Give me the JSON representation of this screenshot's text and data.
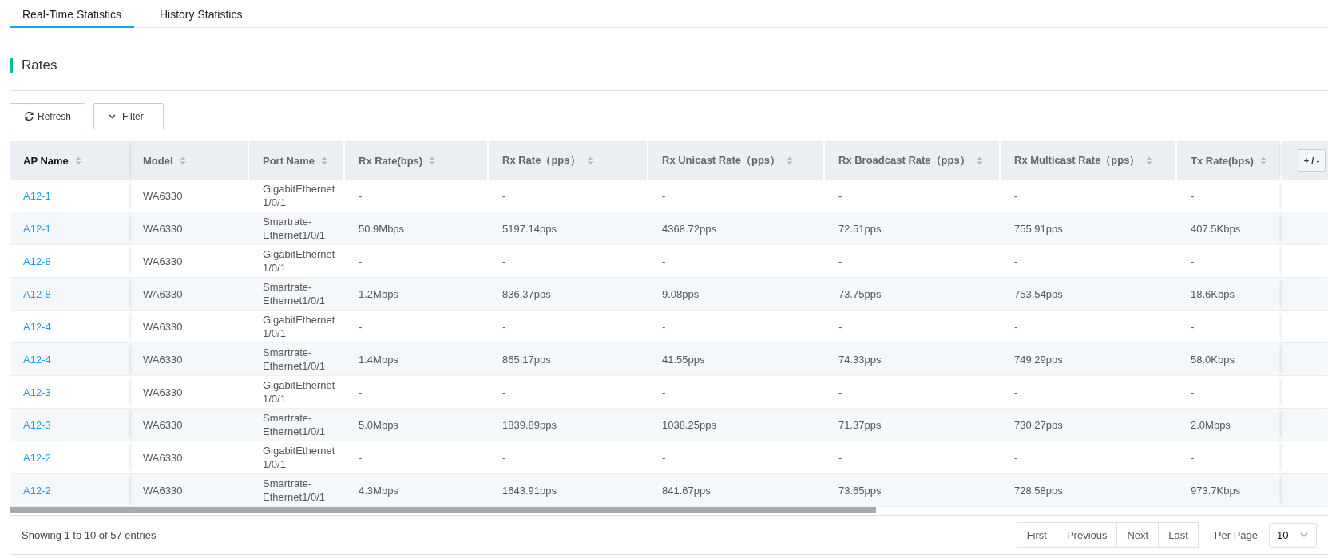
{
  "tabs": [
    {
      "label": "Real-Time Statistics",
      "selected": true
    },
    {
      "label": "History Statistics",
      "selected": false
    }
  ],
  "section": {
    "title": "Rates"
  },
  "toolbar": {
    "refresh": "Refresh",
    "filter": "Filter"
  },
  "table": {
    "columns": [
      {
        "label": "AP Name",
        "sorted": true
      },
      {
        "label": "Model",
        "sorted": false
      },
      {
        "label": "Port Name",
        "sorted": false
      },
      {
        "label": "Rx Rate(bps)",
        "sorted": false
      },
      {
        "label": "Rx Rate（pps）",
        "sorted": false
      },
      {
        "label": "Rx Unicast Rate（pps）",
        "sorted": false
      },
      {
        "label": "Rx Broadcast Rate（pps）",
        "sorted": false
      },
      {
        "label": "Rx Multicast Rate（pps）",
        "sorted": false
      },
      {
        "label": "Tx Rate(bps)",
        "sorted": false
      }
    ],
    "column_toggle": "+ / -",
    "rows": [
      [
        "A12-1",
        "WA6330",
        "GigabitEthernet 1/0/1",
        "-",
        "-",
        "-",
        "-",
        "-",
        "-"
      ],
      [
        "A12-1",
        "WA6330",
        "Smartrate-Ethernet1/0/1",
        "50.9Mbps",
        "5197.14pps",
        "4368.72pps",
        "72.51pps",
        "755.91pps",
        "407.5Kbps"
      ],
      [
        "A12-8",
        "WA6330",
        "GigabitEthernet 1/0/1",
        "-",
        "-",
        "-",
        "-",
        "-",
        "-"
      ],
      [
        "A12-8",
        "WA6330",
        "Smartrate-Ethernet1/0/1",
        "1.2Mbps",
        "836.37pps",
        "9.08pps",
        "73.75pps",
        "753.54pps",
        "18.6Kbps"
      ],
      [
        "A12-4",
        "WA6330",
        "GigabitEthernet 1/0/1",
        "-",
        "-",
        "-",
        "-",
        "-",
        "-"
      ],
      [
        "A12-4",
        "WA6330",
        "Smartrate-Ethernet1/0/1",
        "1.4Mbps",
        "865.17pps",
        "41.55pps",
        "74.33pps",
        "749.29pps",
        "58.0Kbps"
      ],
      [
        "A12-3",
        "WA6330",
        "GigabitEthernet 1/0/1",
        "-",
        "-",
        "-",
        "-",
        "-",
        "-"
      ],
      [
        "A12-3",
        "WA6330",
        "Smartrate-Ethernet1/0/1",
        "5.0Mbps",
        "1839.89pps",
        "1038.25pps",
        "71.37pps",
        "730.27pps",
        "2.0Mbps"
      ],
      [
        "A12-2",
        "WA6330",
        "GigabitEthernet 1/0/1",
        "-",
        "-",
        "-",
        "-",
        "-",
        "-"
      ],
      [
        "A12-2",
        "WA6330",
        "Smartrate-Ethernet1/0/1",
        "4.3Mbps",
        "1643.91pps",
        "841.67pps",
        "73.65pps",
        "728.58pps",
        "973.7Kbps"
      ]
    ]
  },
  "footer": {
    "summary": "Showing 1 to 10 of 57 entries",
    "pages": [
      "First",
      "Previous",
      "Next",
      "Last"
    ],
    "per_page_label": "Per Page",
    "per_page": "10"
  }
}
